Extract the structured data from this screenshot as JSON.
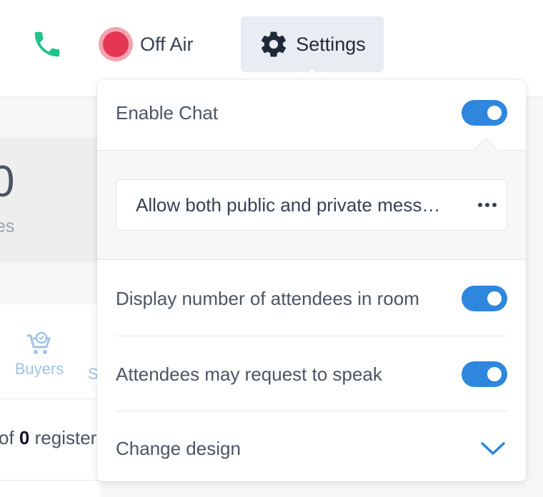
{
  "header": {
    "call_icon": "phone-icon",
    "call_color": "#1ec48a",
    "status": {
      "label": "Off Air",
      "color": "#e53655"
    },
    "settings": {
      "label": "Settings",
      "icon": "gear-icon"
    }
  },
  "background": {
    "stat": {
      "value": "0",
      "label": "es"
    },
    "tabs": [
      {
        "label": "Buyers",
        "icon": "cart-check-icon"
      },
      {
        "label": "S"
      }
    ],
    "registrants": {
      "prefix": "of",
      "count": "0",
      "suffix": "register"
    }
  },
  "settings_menu": {
    "enable_chat": {
      "label": "Enable Chat",
      "enabled": true
    },
    "chat_mode": {
      "value": "Allow both public and private mess…"
    },
    "display_attendees": {
      "label": "Display number of attendees in room",
      "enabled": true
    },
    "request_to_speak": {
      "label": "Attendees may request to speak",
      "enabled": true
    },
    "change_design": {
      "label": "Change design",
      "icon": "chevron-down-icon"
    }
  },
  "colors": {
    "accent": "#2f86dd",
    "off_air": "#e53655",
    "call": "#1ec48a",
    "buyers_tab": "#9fc3e6"
  }
}
